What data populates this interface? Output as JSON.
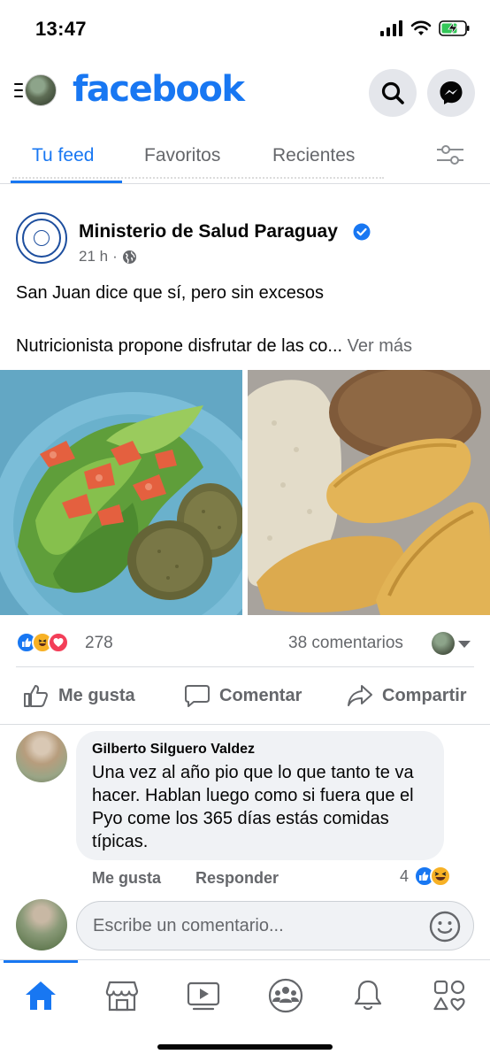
{
  "status_bar": {
    "time": "13:47"
  },
  "header": {
    "logo": "facebook"
  },
  "tabs": [
    {
      "label": "Tu feed",
      "active": true
    },
    {
      "label": "Favoritos",
      "active": false
    },
    {
      "label": "Recientes",
      "active": false
    }
  ],
  "post": {
    "page_name": "Ministerio de Salud Paraguay",
    "time": "21 h",
    "separator": "·",
    "text_line1": "San Juan dice que sí, pero sin excesos",
    "text_line2": "Nutricionista propone disfrutar de las co...",
    "see_more": "Ver más",
    "reaction_count": "278",
    "comments_count": "38 comentarios",
    "actions": {
      "like": "Me gusta",
      "comment": "Comentar",
      "share": "Compartir"
    }
  },
  "comment": {
    "author": "Gilberto Silguero Valdez",
    "text": "Una vez al año pio que lo que tanto te va hacer. Hablan  luego como si fuera que el Pyo come los 365 días estás comidas típicas.",
    "like_label": "Me gusta",
    "reply_label": "Responder",
    "reaction_count": "4"
  },
  "composer": {
    "placeholder": "Escribe un comentario..."
  },
  "bottom_nav": [
    "home",
    "marketplace",
    "watch",
    "groups",
    "notifications",
    "menu"
  ],
  "colors": {
    "brand": "#1877f2",
    "secondary_text": "#65676b",
    "like": "#1877f2",
    "love": "#f33e58",
    "haha": "#f7b125"
  }
}
